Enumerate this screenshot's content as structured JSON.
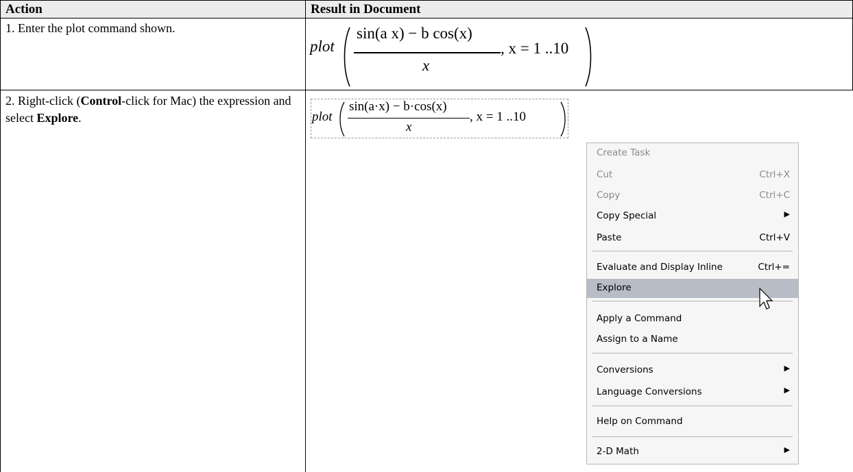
{
  "table": {
    "headers": [
      "Action",
      "Result in Document"
    ],
    "rows": [
      {
        "step": "1.",
        "text": "Enter the plot command shown."
      },
      {
        "step": "2.",
        "text_parts": [
          "Right-click (",
          "Control",
          "-click for Mac) the expression and select ",
          "Explore",
          "."
        ]
      }
    ]
  },
  "math": {
    "fn": "plot",
    "numerator_1": "sin(a x) − b cos(x)",
    "denominator": "x",
    "range": ", x = 1 ..10",
    "numerator_2": "sin(a·x) − b·cos(x)"
  },
  "context_menu": {
    "items": [
      {
        "label": "Create Task",
        "shortcut": "",
        "submenu": false,
        "disabled": true
      },
      {
        "label": "Cut",
        "shortcut": "Ctrl+X",
        "submenu": false,
        "disabled": true
      },
      {
        "label": "Copy",
        "shortcut": "Ctrl+C",
        "submenu": false,
        "disabled": true
      },
      {
        "label": "Copy Special",
        "shortcut": "",
        "submenu": true,
        "disabled": false
      },
      {
        "label": "Paste",
        "shortcut": "Ctrl+V",
        "submenu": false,
        "disabled": false
      },
      {
        "label": "Evaluate and Display Inline",
        "shortcut": "Ctrl+=",
        "submenu": false,
        "disabled": false
      },
      {
        "label": "Explore",
        "shortcut": "",
        "submenu": false,
        "disabled": false,
        "highlighted": true
      },
      {
        "label": "Apply a Command",
        "shortcut": "",
        "submenu": false,
        "disabled": false
      },
      {
        "label": "Assign to a Name",
        "shortcut": "",
        "submenu": false,
        "disabled": false
      },
      {
        "label": "Conversions",
        "shortcut": "",
        "submenu": true,
        "disabled": false
      },
      {
        "label": "Language Conversions",
        "shortcut": "",
        "submenu": true,
        "disabled": false
      },
      {
        "label": "Help on Command",
        "shortcut": "",
        "submenu": false,
        "disabled": false
      },
      {
        "label": "2-D Math",
        "shortcut": "",
        "submenu": true,
        "disabled": false
      }
    ]
  },
  "colors": {
    "header_bg": "#ececec",
    "menu_bg": "#f6f6f6",
    "highlight": "#b8bcc6",
    "disabled_text": "#8a8a8a"
  }
}
